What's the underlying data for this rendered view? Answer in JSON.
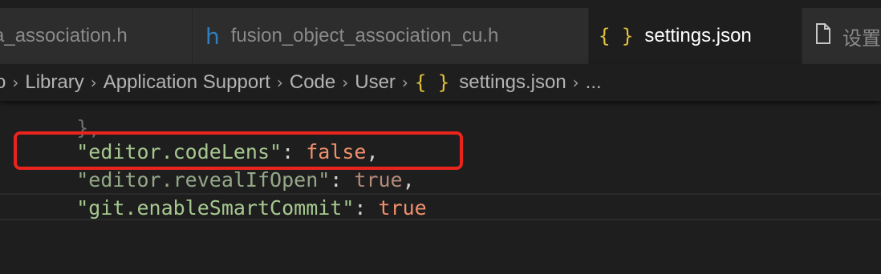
{
  "tabs": [
    {
      "label": "a_association.h",
      "icon": "h-file-icon",
      "active": false
    },
    {
      "label": "fusion_object_association_cu.h",
      "icon": "h-file-icon",
      "active": false
    },
    {
      "label": "settings.json",
      "icon": "json-icon",
      "active": true
    },
    {
      "label": "设置",
      "icon": "document-icon",
      "active": false
    }
  ],
  "icons": {
    "h": "h",
    "json": "{ }"
  },
  "breadcrumb": {
    "items": [
      "o",
      "Library",
      "Application Support",
      "Code",
      "User",
      "settings.json",
      "..."
    ],
    "separator": "›"
  },
  "editor": {
    "lines": [
      {
        "text": "},"
      },
      {
        "key": "\"editor.codeLens\"",
        "colon": ": ",
        "value": "false",
        "tail": ","
      },
      {
        "key": "\"editor.revealIfOpen\"",
        "colon": ": ",
        "value": "true",
        "tail": ","
      },
      {
        "key": "\"git.enableSmartCommit\"",
        "colon": ": ",
        "value": "true",
        "tail": ""
      }
    ]
  },
  "colors": {
    "highlight_box": "#e8241d",
    "string": "#a6c78f",
    "keyword": "#f08f6c",
    "json_icon": "#e2c13c",
    "h_icon": "#2f7fc1"
  }
}
